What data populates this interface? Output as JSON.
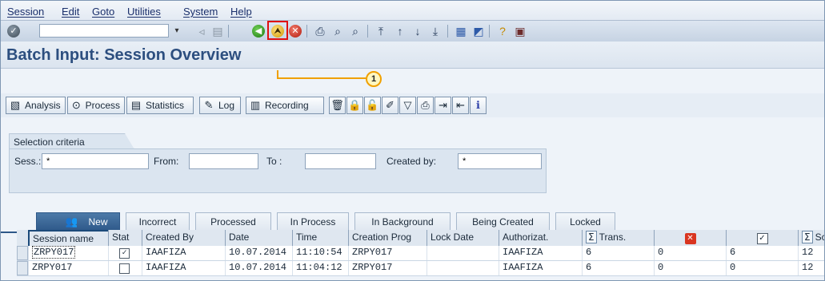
{
  "menu": [
    "Session",
    "Edit",
    "Goto",
    "Utilities",
    "System",
    "Help"
  ],
  "toolbar": {
    "command_value": "",
    "icons": [
      "ok-icon",
      "save-icon",
      "back-icon",
      "exit-icon",
      "cancel-icon",
      "print-icon",
      "find-icon",
      "find-next-icon",
      "first-page-icon",
      "previous-page-icon",
      "next-page-icon",
      "last-page-icon",
      "new-session-icon",
      "shortcut-icon",
      "help-icon",
      "layout-icon"
    ]
  },
  "title": "Batch Input: Session Overview",
  "callout_number": "1",
  "app_toolbar": {
    "analysis": "Analysis",
    "process": "Process",
    "statistics": "Statistics",
    "log": "Log",
    "recording": "Recording"
  },
  "selection": {
    "tab_label": "Selection criteria",
    "sess_label": "Sess.:",
    "sess_value": "*",
    "from_label": "From:",
    "from_value": "",
    "to_label": "To :",
    "to_value": "",
    "created_by_label": "Created by:",
    "created_by_value": "*"
  },
  "tabs": [
    "New",
    "Incorrect",
    "Processed",
    "In Process",
    "In Background",
    "Being Created",
    "Locked"
  ],
  "table": {
    "headers": [
      "Session name",
      "Stat",
      "Created By",
      "Date",
      "Time",
      "Creation Prog",
      "Lock Date",
      "Authorizat.",
      "Trans.",
      "",
      "",
      "Screens"
    ],
    "rows": [
      [
        "ZRPY017",
        "processed",
        "IAAFIZA",
        "10.07.2014",
        "11:10:54",
        "ZRPY017",
        "",
        "IAAFIZA",
        "6",
        "0",
        "6",
        "12"
      ],
      [
        "ZRPY017",
        "new",
        "IAAFIZA",
        "10.07.2014",
        "11:04:12",
        "ZRPY017",
        "",
        "IAAFIZA",
        "6",
        "0",
        "0",
        "12"
      ]
    ]
  },
  "colors": {
    "title": "#2c4e7f",
    "highlight": "#e01010",
    "callout": "#f0a000",
    "active_tab": "#2d5788"
  }
}
